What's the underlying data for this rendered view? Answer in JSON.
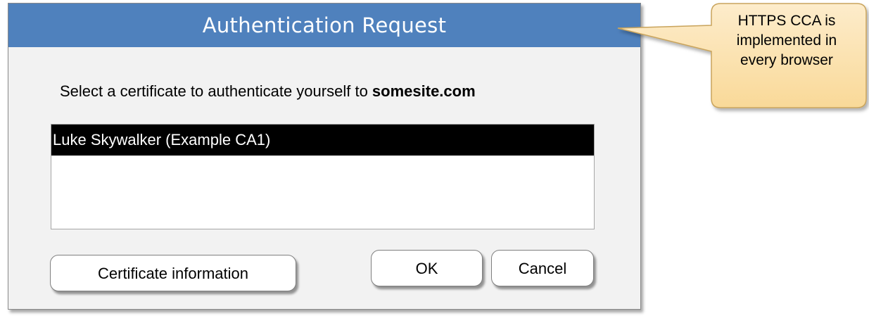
{
  "dialog": {
    "title": "Authentication Request",
    "prompt_text": "Select a certificate to authenticate yourself to ",
    "prompt_site": "somesite.com",
    "certificates": [
      {
        "label": "Luke Skywalker (Example CA1)",
        "selected": true
      }
    ],
    "buttons": {
      "certificate_info": "Certificate information",
      "ok": "OK",
      "cancel": "Cancel"
    }
  },
  "callout": {
    "lines": [
      "HTTPS CCA is",
      "implemented in",
      "every browser"
    ]
  },
  "colors": {
    "titlebar": "#4f81bd",
    "dialog_bg": "#f2f2f2",
    "selected_row": "#000000",
    "callout_bg": "#fce4b6",
    "callout_border": "#c9a45c"
  }
}
